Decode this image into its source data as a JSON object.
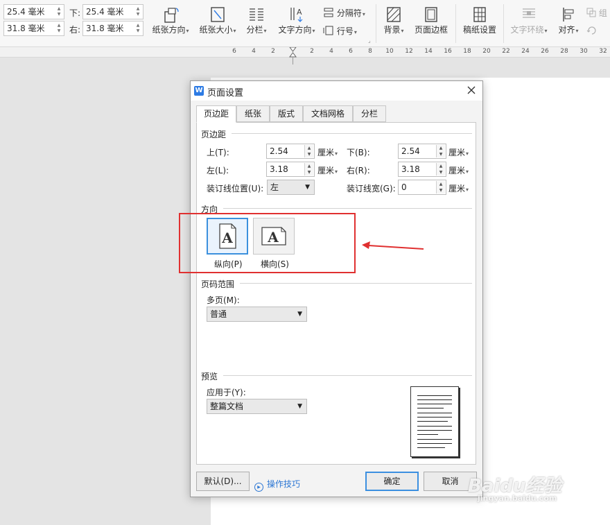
{
  "toolbar": {
    "margins": {
      "top_value": "25.4 毫米",
      "bottom_label": "下:",
      "bottom_value": "25.4 毫米",
      "left_value": "31.8 毫米",
      "right_label": "右:",
      "right_value": "31.8 毫米"
    },
    "buttons": {
      "paper_orientation": "纸张方向",
      "paper_size": "纸张大小",
      "columns": "分栏",
      "text_direction": "文字方向",
      "separator": "分隔符",
      "line_number": "行号",
      "background": "背景",
      "page_border": "页面边框",
      "manuscript_setup": "稿纸设置",
      "text_wrap": "文字环绕",
      "align": "对齐",
      "group_partial": "组"
    }
  },
  "ruler": {
    "ticks": [
      "6",
      "4",
      "2",
      "2",
      "4",
      "6",
      "8",
      "10",
      "12",
      "14",
      "16",
      "18",
      "20",
      "22",
      "24",
      "26",
      "28",
      "30",
      "32"
    ]
  },
  "dialog": {
    "title": "页面设置",
    "tabs": [
      "页边距",
      "纸张",
      "版式",
      "文档网格",
      "分栏"
    ],
    "active_tab": "页边距",
    "margins_section": {
      "heading": "页边距",
      "top": {
        "label": "上(T):",
        "value": "2.54",
        "unit": "厘米"
      },
      "bottom": {
        "label": "下(B):",
        "value": "2.54",
        "unit": "厘米"
      },
      "left": {
        "label": "左(L):",
        "value": "3.18",
        "unit": "厘米"
      },
      "right": {
        "label": "右(R):",
        "value": "3.18",
        "unit": "厘米"
      },
      "gutter_position": {
        "label": "装订线位置(U):",
        "value": "左"
      },
      "gutter_width": {
        "label": "装订线宽(G):",
        "value": "0",
        "unit": "厘米"
      }
    },
    "orientation_section": {
      "heading": "方向",
      "portrait": {
        "label": "纵向(P)",
        "glyph": "A",
        "selected": true
      },
      "landscape": {
        "label": "横向(S)",
        "glyph": "A",
        "selected": false
      }
    },
    "page_range_section": {
      "heading": "页码范围",
      "multi_page_label": "多页(M):",
      "multi_page_value": "普通"
    },
    "preview_section": {
      "heading": "预览",
      "apply_to_label": "应用于(Y):",
      "apply_to_value": "整篇文档"
    },
    "buttons": {
      "default": "默认(D)...",
      "tips": "操作技巧",
      "ok": "确定",
      "cancel": "取消"
    }
  },
  "watermark": {
    "main": "Baidu经验",
    "url": "jingyan.baidu.com"
  },
  "colors": {
    "selection_blue": "#3b90dd",
    "annotation_red": "#e03030",
    "link_blue": "#2c77d4"
  }
}
